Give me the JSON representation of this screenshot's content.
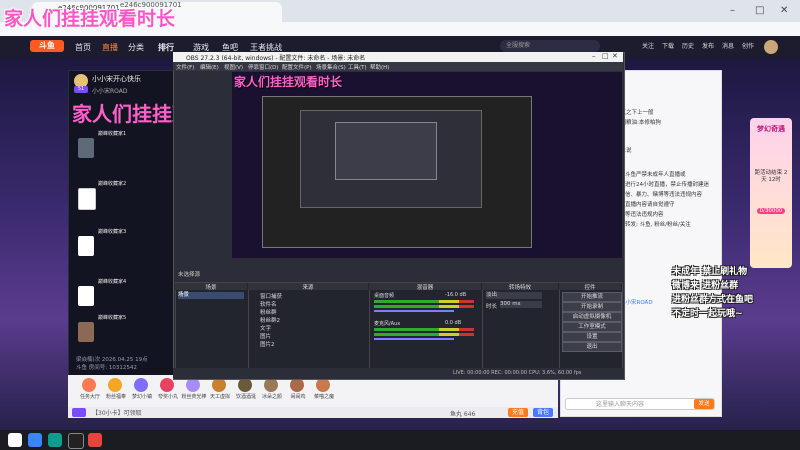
{
  "overlay": {
    "title": "家人们挂挂观看时长",
    "rules": [
      "未成年 禁止刷礼物",
      "微博来 进粉丝群",
      "进粉丝群方式在鱼吧",
      "不定时一起玩哦~"
    ]
  },
  "browser": {
    "tab_text": "e246c900091701",
    "url": "e246c900091701"
  },
  "site": {
    "logo": "斗鱼",
    "nav": [
      "首页",
      "直播",
      "分类",
      "排行",
      "游戏",
      "鱼吧",
      "王者挑战"
    ],
    "search_placeholder": "全服搜索",
    "header_icons": [
      "关注",
      "下载",
      "历史",
      "发布",
      "消息",
      "创作"
    ]
  },
  "streamer": {
    "name": "小小宋开心快乐",
    "sub": "小小宋ROAD",
    "level": "51",
    "viewer_stats": [
      "梁焱楠(次 2026.04.25 19点",
      "斗鱼 房间号: 10312542"
    ],
    "slots": [
      "巅峰收藏家1",
      "巅峰收藏家2",
      "巅峰收藏家3",
      "巅峰收藏家4",
      "巅峰收藏家5"
    ]
  },
  "gifts": [
    {
      "label": "任务大厅",
      "color": "#ff7b52"
    },
    {
      "label": "粉丝福奉",
      "color": "#f5a623"
    },
    {
      "label": "梦幻小镇",
      "color": "#7f6fff"
    },
    {
      "label": "夸奖小丸",
      "color": "#e94363"
    },
    {
      "label": "粉丝荧光棒",
      "color": "#a88cff"
    },
    {
      "label": "天工虚拟",
      "color": "#c9812e"
    },
    {
      "label": "饮酒酒涎",
      "color": "#6b5a3a"
    },
    {
      "label": "冰朵之颜",
      "color": "#9a7a55"
    },
    {
      "label": "闹闹鸡",
      "color": "#aa6a4a"
    },
    {
      "label": "菜喵之魔",
      "color": "#c97a4a"
    }
  ],
  "bottom": {
    "text": "【30小卡】可领取",
    "coins": "鱼丸 646",
    "send": "充值",
    "broadcast": "背包"
  },
  "chat": {
    "lines": [
      "一气之下上一般",
      "中国粮油:本修柏狗",
      "小象说",
      "斗鱼严禁未成年人直播或",
      "进行24小时直播，禁止传播封建迷",
      "信、暴力、赌博等违法违规内容",
      "直播内容请自觉遵守",
      "等违法违规内容",
      "转发: 斗鱼, 粉丝/粉丝/关注",
      "小小宋ROAD"
    ],
    "input_placeholder": "这里输入聊天内容",
    "send": "发送"
  },
  "event": {
    "title": "梦幻奇遇",
    "timer": "距活动结束 2天 12时",
    "progress": "0/30000"
  },
  "obs": {
    "title": "OBS 27.2.3 (64-bit, windows) - 配置文件: 未命名 - 场景: 未命名",
    "menus": [
      "文件(F)",
      "编辑(E)",
      "视图(V)",
      "停靠窗口(D)",
      "配置文件(P)",
      "场景集合(S)",
      "工具(T)",
      "帮助(H)"
    ],
    "preview_title": "家人们挂挂观看时长",
    "dock_label": "未选择源",
    "dock_headers": [
      "场景",
      "来源",
      "混音器",
      "转场特效",
      "控件"
    ],
    "scene": "场景",
    "sources": [
      "窗口捕获",
      "软件名",
      "粉丝群",
      "粉丝群2",
      "文字",
      "图片",
      "图片2"
    ],
    "mixer": [
      {
        "label": "桌面音频",
        "db": "-16.0 dB"
      },
      {
        "label": "麦克风/Aux",
        "db": "0.0 dB"
      }
    ],
    "transition": {
      "type": "淡出",
      "duration_label": "时长",
      "duration": "300 ms"
    },
    "controls": [
      "开始推流",
      "开始录制",
      "启动虚拟摄像机",
      "工作室模式",
      "设置",
      "退出"
    ],
    "status": "LIVE: 00:00:00   REC: 00:00:00   CPU: 3.6%, 60.00 fps"
  }
}
